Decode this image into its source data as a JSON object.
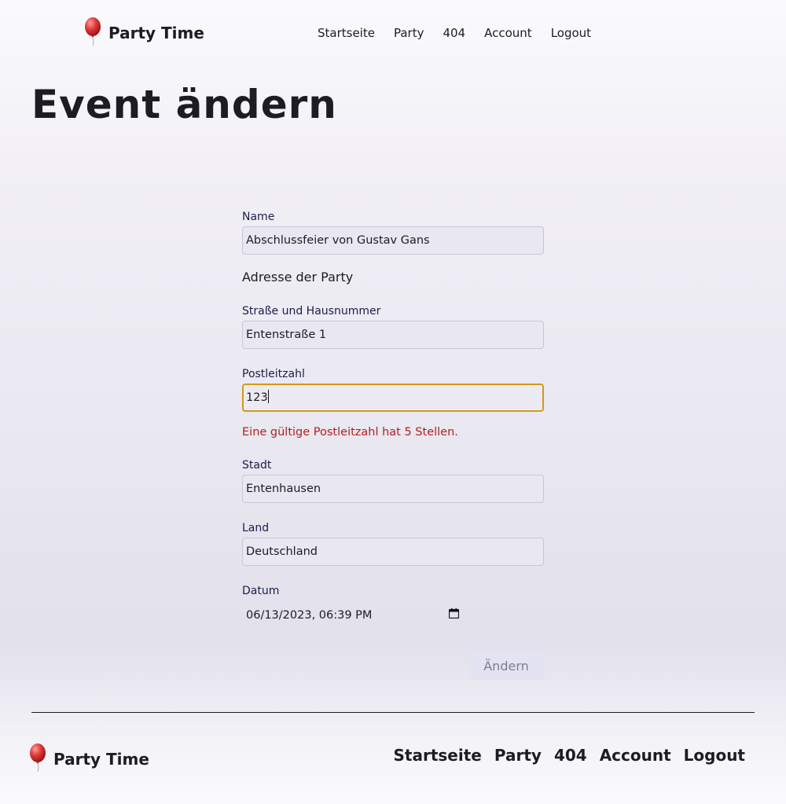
{
  "header": {
    "brand": "Party Time",
    "nav": [
      "Startseite",
      "Party",
      "404",
      "Account",
      "Logout"
    ]
  },
  "page_title": "Event ändern",
  "form": {
    "name_label": "Name",
    "name_value": "Abschlussfeier von Gustav Gans",
    "address_heading": "Adresse der Party",
    "street_label": "Straße und Hausnummer",
    "street_value": "Entenstraße 1",
    "zip_label": "Postleitzahl",
    "zip_value": "123",
    "zip_error": "Eine gültige Postleitzahl hat 5 Stellen.",
    "city_label": "Stadt",
    "city_value": "Entenhausen",
    "country_label": "Land",
    "country_value": "Deutschland",
    "date_label": "Datum",
    "date_value": "06/13/2023, 06:39 PM",
    "submit_label": "Ändern"
  },
  "footer": {
    "brand": "Party Time",
    "nav": [
      "Startseite",
      "Party",
      "404",
      "Account",
      "Logout"
    ]
  },
  "colors": {
    "error": "#b21f1f",
    "focus_border": "#d49a16",
    "balloon": "#e03b3b"
  },
  "icons": [
    "balloon-icon",
    "calendar-icon"
  ]
}
